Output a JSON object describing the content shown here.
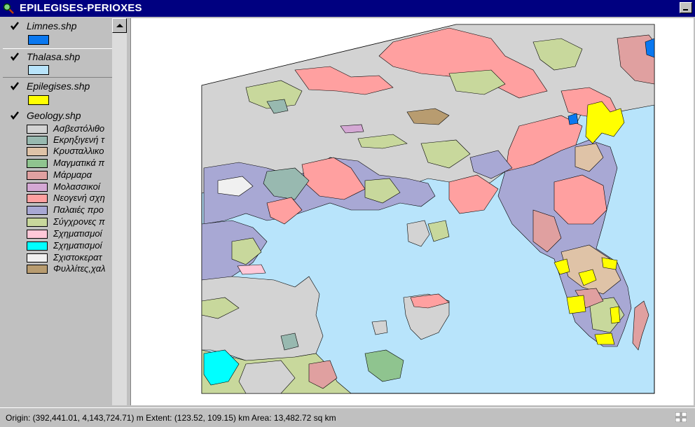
{
  "window": {
    "title": "EPILEGISES-PERIOXES"
  },
  "toc": {
    "themes": [
      {
        "name": "Limnes.shp",
        "checked": true,
        "color": "#0a78f0"
      },
      {
        "name": "Thalasa.shp",
        "checked": true,
        "color": "#b8e4fb"
      },
      {
        "name": "Epilegises.shp",
        "checked": true,
        "color": "#ffff00"
      },
      {
        "name": "Geology.shp",
        "checked": true
      }
    ],
    "geology_legend": [
      {
        "label": "Ασβεστόλιθο",
        "color": "#d3d3d3"
      },
      {
        "label": "Εκρηξιγενή τ",
        "color": "#98b9b0"
      },
      {
        "label": "Κρυσταλλικο",
        "color": "#dfc3a7"
      },
      {
        "label": "Μαγματικά π",
        "color": "#8fc48f"
      },
      {
        "label": "Μάρμαρα",
        "color": "#e0a0a0"
      },
      {
        "label": "Μολασσικοί",
        "color": "#d4a8d4"
      },
      {
        "label": "Νεογενή σχη",
        "color": "#ffa0a0"
      },
      {
        "label": "Παλαιές προ",
        "color": "#a8a8d4"
      },
      {
        "label": "Σύγχρονες π",
        "color": "#c8d89c"
      },
      {
        "label": "Σχηματισμοί",
        "color": "#ffc8d8"
      },
      {
        "label": "Σχηματισμοί",
        "color": "#00ffff"
      },
      {
        "label": "Σχιστοκερατ",
        "color": "#f0f0f0"
      },
      {
        "label": "Φυλλίτες,χαλ",
        "color": "#b89c70"
      }
    ]
  },
  "status": {
    "text": "Origin: (392,441.01, 4,143,724.71) m  Extent: (123.52, 109.15) km  Area: 13,482.72 sq km"
  }
}
